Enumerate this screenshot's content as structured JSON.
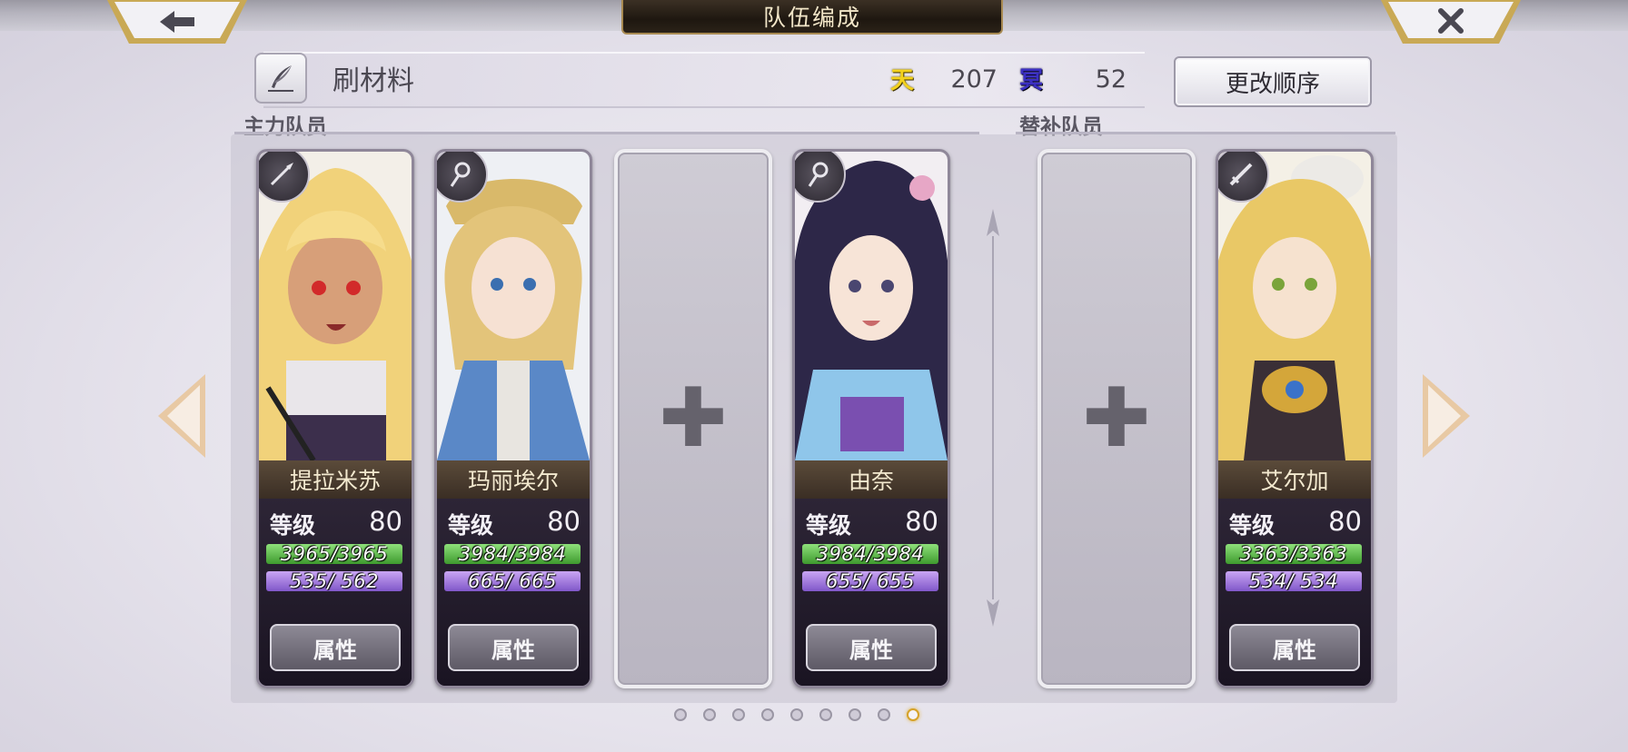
{
  "header": {
    "title": "队伍编成",
    "back_icon": "back-arrow-icon",
    "close_icon": "close-icon"
  },
  "team": {
    "name": "刷材料",
    "resources": [
      {
        "icon": "天",
        "value": "207"
      },
      {
        "icon": "冥",
        "value": "52"
      }
    ],
    "order_button": "更改顺序"
  },
  "sections": {
    "main": "主力队员",
    "reserve": "替补队员"
  },
  "cards": [
    {
      "name": "提拉米苏",
      "level_label": "等级",
      "level": "80",
      "hp": "3965/3965",
      "mp": "535/ 562",
      "button": "属性",
      "weapon": "spear-icon"
    },
    {
      "name": "玛丽埃尔",
      "level_label": "等级",
      "level": "80",
      "hp": "3984/3984",
      "mp": "665/ 665",
      "button": "属性",
      "weapon": "staff-icon"
    },
    {
      "name": "由奈",
      "level_label": "等级",
      "level": "80",
      "hp": "3984/3984",
      "mp": "655/ 655",
      "button": "属性",
      "weapon": "staff-icon"
    },
    {
      "name": "艾尔加",
      "level_label": "等级",
      "level": "80",
      "hp": "3363/3363",
      "mp": "534/ 534",
      "button": "属性",
      "weapon": "sword-icon"
    }
  ],
  "empty_slot_symbol": "✚",
  "pagination": {
    "total": 9,
    "active_index": 8
  },
  "colors": {
    "title_plate": "#1e1710",
    "hp_bar": "#3e9a2e",
    "mp_bar": "#8057c9",
    "active_dot": "#d6a22a"
  }
}
